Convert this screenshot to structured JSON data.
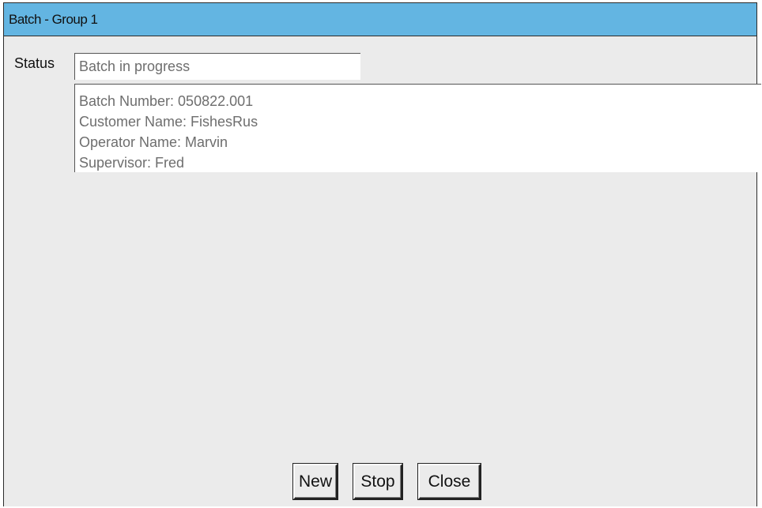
{
  "window": {
    "title": "Batch - Group 1"
  },
  "status": {
    "label": "Status",
    "value": "Batch in progress"
  },
  "info": {
    "lines": [
      "Batch Number: 050822.001",
      "Customer Name: FishesRus",
      "Operator Name: Marvin",
      "Supervisor: Fred"
    ]
  },
  "buttons": {
    "new_label": "New",
    "stop_label": "Stop",
    "close_label": "Close"
  },
  "colors": {
    "title_bar": "#63b5e2",
    "panel_background": "#ebebeb",
    "field_text": "#6e6e6e"
  }
}
